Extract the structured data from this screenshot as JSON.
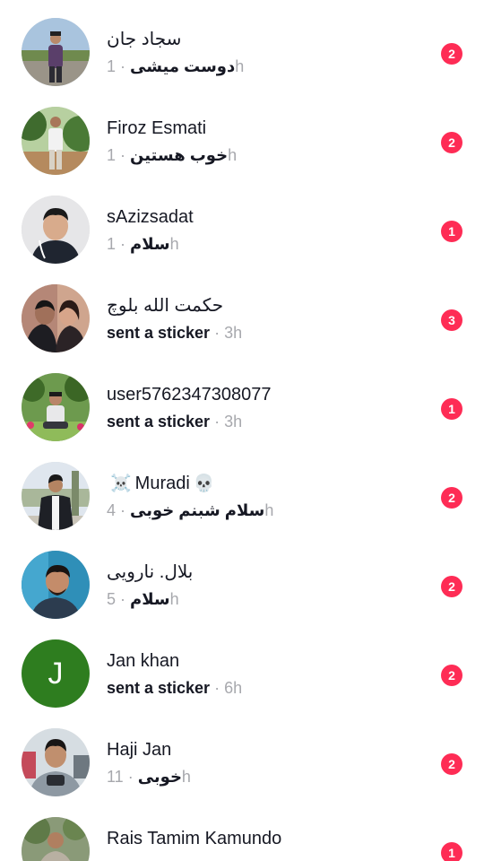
{
  "colors": {
    "badge": "#fe2c55",
    "name_text": "#161823",
    "time_text": "#a7a8ad",
    "letter_avatar_bg": "#2e7d1f"
  },
  "separator": "·",
  "conversations": [
    {
      "name": "سجاد جان",
      "message": "دوست میشی",
      "time": "1h",
      "unread": "2",
      "avatar": "photo"
    },
    {
      "name": "Firoz Esmati",
      "message": "خوب هستین",
      "time": "1h",
      "unread": "2",
      "avatar": "photo"
    },
    {
      "name": "sAzizsadat",
      "message": "سلام",
      "time": "1h",
      "unread": "1",
      "avatar": "photo"
    },
    {
      "name": "حکمت الله بلوچ",
      "message": "sent a sticker",
      "time": "3h",
      "unread": "3",
      "avatar": "photo"
    },
    {
      "name": "user5762347308077",
      "message": "sent a sticker",
      "time": "3h",
      "unread": "1",
      "avatar": "photo"
    },
    {
      "name": "Muradi",
      "name_prefix_emoji": "☠️",
      "name_suffix_emoji": "💀",
      "message": "سلام شبنم خوبی",
      "time": "4h",
      "unread": "2",
      "avatar": "photo"
    },
    {
      "name": "بلال. نارویی",
      "message": "سلام",
      "time": "5h",
      "unread": "2",
      "avatar": "photo"
    },
    {
      "name": "Jan khan",
      "message": "sent a sticker",
      "time": "6h",
      "unread": "2",
      "avatar": "letter",
      "avatar_letter": "J"
    },
    {
      "name": "Haji Jan",
      "message": "خوبی",
      "time": "11h",
      "unread": "2",
      "avatar": "photo"
    },
    {
      "name": "Rais Tamim Kamundo",
      "message": "",
      "time": "",
      "unread": "1",
      "avatar": "photo"
    }
  ]
}
